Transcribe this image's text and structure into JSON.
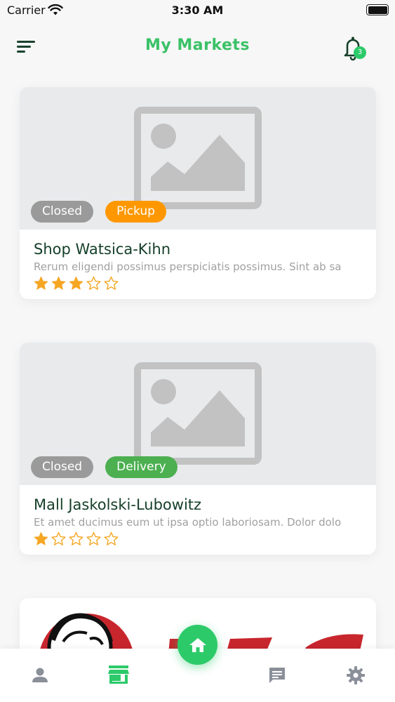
{
  "status_bar": {
    "carrier": "Carrier",
    "time": "3:30 AM"
  },
  "header": {
    "title": "My Markets",
    "notification_count": "3"
  },
  "markets": [
    {
      "name": "Shop Watsica-Kihn",
      "description": "Rerum eligendi possimus perspiciatis possimus. Sint ab sa",
      "status_tag": "Closed",
      "service_tag": "Pickup",
      "rating": 3,
      "max_rating": 5
    },
    {
      "name": "Mall Jaskolski-Lubowitz",
      "description": "Et amet ducimus eum ut ipsa optio laboriosam. Dolor dolo",
      "status_tag": "Closed",
      "service_tag": "Delivery",
      "rating": 1,
      "max_rating": 5
    }
  ],
  "bottom_nav": {
    "items": [
      "account-icon",
      "store-icon",
      "home-icon",
      "chat-icon",
      "settings-icon"
    ],
    "active": "store-icon"
  },
  "colors": {
    "accent": "#2dca6a",
    "title": "#3bc167",
    "pickup": "#ff9800",
    "delivery": "#4caf50",
    "closed": "#9a9a9a",
    "star": "#f5a623"
  }
}
